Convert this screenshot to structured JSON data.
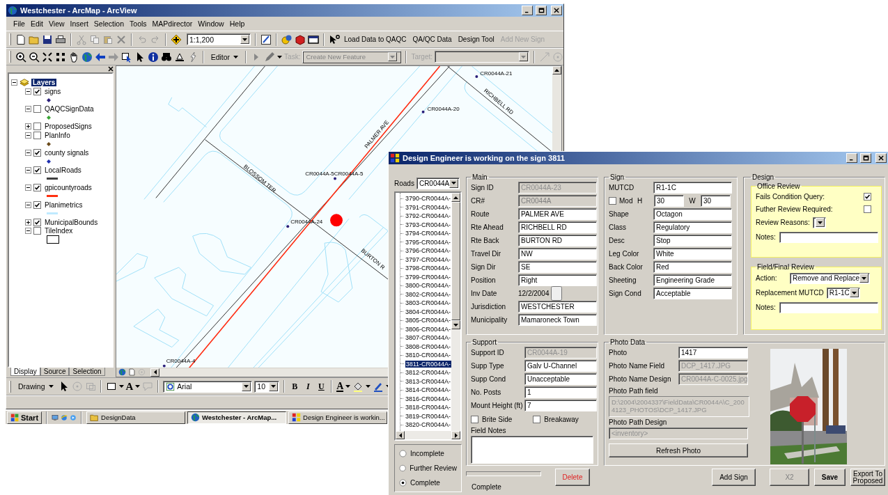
{
  "arcmap": {
    "title": "Westchester - ArcMap - ArcView",
    "menu": [
      "File",
      "Edit",
      "View",
      "Insert",
      "Selection",
      "Tools",
      "MAPdirector",
      "Window",
      "Help"
    ],
    "scale": "1:1,200",
    "commands": [
      {
        "label": "Load Data to QAQC",
        "disabled": false
      },
      {
        "label": "QA/QC Data",
        "disabled": false
      },
      {
        "label": "Design Tool",
        "disabled": false
      },
      {
        "label": "Add New Sign",
        "disabled": true
      }
    ],
    "editor": {
      "menu": "Editor",
      "task_label": "Task:",
      "task": "Create New Feature",
      "target_label": "Target:"
    },
    "toc": {
      "root": "Layers",
      "layers": [
        {
          "name": "signs",
          "checked": true,
          "expanded": true,
          "kind": "point",
          "color": "#2b1f7a"
        },
        {
          "name": "QAQCSignData",
          "checked": false,
          "expanded": true,
          "kind": "point",
          "color": "#3aa535"
        },
        {
          "name": "ProposedSigns",
          "checked": false,
          "expanded": false
        },
        {
          "name": "PlanInfo",
          "checked": false,
          "expanded": true,
          "kind": "point",
          "color": "#6b4a1a"
        },
        {
          "name": "county signals",
          "checked": true,
          "expanded": true,
          "kind": "point",
          "color": "#2030b0"
        },
        {
          "name": "LocalRoads",
          "checked": true,
          "expanded": true,
          "kind": "line",
          "color": "#404040"
        },
        {
          "name": "gpicountyroads",
          "checked": true,
          "expanded": true,
          "kind": "line",
          "color": "#ff3010"
        },
        {
          "name": "Planimetrics",
          "checked": true,
          "expanded": true,
          "kind": "line",
          "color": "#bfeaff"
        },
        {
          "name": "MunicipalBounds",
          "checked": true,
          "expanded": false
        },
        {
          "name": "TileIndex",
          "checked": false,
          "expanded": true,
          "kind": "polygon"
        }
      ],
      "tabs": [
        {
          "label": "Display",
          "selected": true
        },
        {
          "label": "Source",
          "selected": false
        },
        {
          "label": "Selection",
          "selected": false
        }
      ]
    },
    "map": {
      "labels": [
        {
          "text": "CR0044A-21",
          "kind": "point"
        },
        {
          "text": "RICHBELL RD",
          "kind": "road"
        },
        {
          "text": "CR0044A-20",
          "kind": "point"
        },
        {
          "text": "PALMER AVE",
          "kind": "road"
        },
        {
          "text": "BLOSSOM TER",
          "kind": "road"
        },
        {
          "text": "CR0044A-5CR0044A-5",
          "kind": "point"
        },
        {
          "text": "CR0044A-24",
          "kind": "point"
        },
        {
          "text": "BURTON R",
          "kind": "road"
        },
        {
          "text": "CR0044A-4",
          "kind": "point"
        }
      ]
    },
    "drawing_toolbar": {
      "menu": "Drawing",
      "text_tool": "A",
      "font": "Arial",
      "size": "10",
      "styles": [
        "B",
        "I",
        "U"
      ],
      "font_color": "A"
    },
    "taskbar": {
      "start": "Start",
      "tasks": [
        {
          "label": "DesignData",
          "selected": false
        },
        {
          "label": "Westchester - ArcMap...",
          "selected": true
        },
        {
          "label": "Design Engineer is workin...",
          "selected": false
        }
      ]
    }
  },
  "dialog": {
    "title": "Design Engineer is working on the sign 3811",
    "roads": {
      "label": "Roads",
      "value": "CR0044A"
    },
    "signs": [
      {
        "label": "3790-CR0044A-",
        "selected": false
      },
      {
        "label": "3791-CR0044A-",
        "selected": false
      },
      {
        "label": "3792-CR0044A-",
        "selected": false
      },
      {
        "label": "3793-CR0044A-",
        "selected": false
      },
      {
        "label": "3794-CR0044A-",
        "selected": false
      },
      {
        "label": "3795-CR0044A-",
        "selected": false
      },
      {
        "label": "3796-CR0044A-",
        "selected": false
      },
      {
        "label": "3797-CR0044A-",
        "selected": false
      },
      {
        "label": "3798-CR0044A-",
        "selected": false
      },
      {
        "label": "3799-CR0044A-",
        "selected": false
      },
      {
        "label": "3800-CR0044A-",
        "selected": false
      },
      {
        "label": "3802-CR0044A-",
        "selected": false
      },
      {
        "label": "3803-CR0044A-",
        "selected": false
      },
      {
        "label": "3804-CR0044A-",
        "selected": false
      },
      {
        "label": "3805-CR0044A-",
        "selected": false
      },
      {
        "label": "3806-CR0044A-",
        "selected": false
      },
      {
        "label": "3807-CR0044A-",
        "selected": false
      },
      {
        "label": "3808-CR0044A-",
        "selected": false
      },
      {
        "label": "3810-CR0044A-",
        "selected": false
      },
      {
        "label": "3811-CR0044A-",
        "selected": true
      },
      {
        "label": "3812-CR0044A-",
        "selected": false
      },
      {
        "label": "3813-CR0044A-",
        "selected": false
      },
      {
        "label": "3814-CR0044A-",
        "selected": false
      },
      {
        "label": "3816-CR0044A-",
        "selected": false
      },
      {
        "label": "3818-CR0044A-",
        "selected": false
      },
      {
        "label": "3819-CR0044A-",
        "selected": false
      },
      {
        "label": "3820-CR0044A-",
        "selected": false
      }
    ],
    "status": [
      {
        "label": "Incomplete",
        "selected": false
      },
      {
        "label": "Further Review",
        "selected": false
      },
      {
        "label": "Complete",
        "selected": true
      }
    ],
    "main": {
      "title": "Main",
      "fields": [
        {
          "label": "Sign ID",
          "value": "CR0044A-23",
          "kind": "text",
          "disabled": true
        },
        {
          "label": "CR#",
          "value": "CR0044A",
          "kind": "select",
          "disabled": true
        },
        {
          "label": "Route",
          "value": "PALMER AVE",
          "kind": "select",
          "disabled": false
        },
        {
          "label": "Rte Ahead",
          "value": "RICHBELL RD",
          "kind": "select",
          "disabled": false
        },
        {
          "label": "Rte Back",
          "value": "BURTON RD",
          "kind": "select",
          "disabled": false
        },
        {
          "label": "Travel Dir",
          "value": "NW",
          "kind": "select",
          "disabled": false
        },
        {
          "label": "Sign Dir",
          "value": "SE",
          "kind": "select",
          "disabled": false
        },
        {
          "label": "Position",
          "value": "Right",
          "kind": "select",
          "disabled": false
        },
        {
          "label": "Inv Date",
          "value": "12/2/2004",
          "kind": "date"
        },
        {
          "label": "Jurisdiction",
          "value": "WESTCHESTER",
          "kind": "select",
          "disabled": false
        },
        {
          "label": "Municipality",
          "value": "Mamaroneck Town",
          "kind": "select",
          "disabled": false
        }
      ]
    },
    "sign": {
      "title": "Sign",
      "mutcd": {
        "label": "MUTCD",
        "value": "R1-1C",
        "kind": "select",
        "disabled": false
      },
      "mod": {
        "label": "Mod",
        "checked": false
      },
      "height": {
        "label": "H",
        "value": "30"
      },
      "width": {
        "label": "W",
        "value": "30"
      },
      "fields": [
        {
          "label": "Shape",
          "value": "Octagon",
          "kind": "select",
          "disabled": false
        },
        {
          "label": "Class",
          "value": "Regulatory",
          "kind": "select",
          "disabled": false
        },
        {
          "label": "Desc",
          "value": "Stop",
          "kind": "select",
          "disabled": false
        },
        {
          "label": "Leg Color",
          "value": "White",
          "kind": "select",
          "disabled": false
        },
        {
          "label": "Back Color",
          "value": "Red",
          "kind": "select",
          "disabled": false
        },
        {
          "label": "Sheeting",
          "value": "Engineering Grade",
          "kind": "select",
          "disabled": false
        },
        {
          "label": "Sign Cond",
          "value": "Acceptable",
          "kind": "select",
          "disabled": false
        }
      ]
    },
    "design": {
      "title": "Design",
      "office": {
        "title": "Office Review",
        "checks": [
          {
            "label": "Fails Condition Query:",
            "checked": true
          },
          {
            "label": "Futher Review Required:",
            "checked": false
          }
        ],
        "reasons_label": "Review Reasons:",
        "notes_label": "Notes:"
      },
      "final": {
        "title": "Field/Final Review",
        "action": {
          "label": "Action:",
          "value": "Remove and Replace"
        },
        "replacement": {
          "label": "Replacement MUTCD",
          "value": "R1-1C"
        },
        "notes_label": "Notes:"
      }
    },
    "support": {
      "title": "Support",
      "fields": [
        {
          "label": "Support ID",
          "value": "CR0044A-19",
          "kind": "text",
          "disabled": true
        },
        {
          "label": "Supp Type",
          "value": "Galv U-Channel",
          "kind": "select",
          "disabled": false
        },
        {
          "label": "Supp Cond",
          "value": "Unacceptable",
          "kind": "select",
          "disabled": false
        },
        {
          "label": "No. Posts",
          "value": "1",
          "kind": "text",
          "disabled": false
        },
        {
          "label": "Mount Height (ft)",
          "value": "7",
          "kind": "text",
          "disabled": false
        }
      ],
      "checks": [
        {
          "label": "Brite Side",
          "checked": false
        },
        {
          "label": "Breakaway",
          "checked": false
        }
      ],
      "notes_label": "Field Notes"
    },
    "photo": {
      "title": "Photo Data",
      "fields": [
        {
          "label": "Photo",
          "value": "1417",
          "kind": "text",
          "disabled": false
        },
        {
          "label": "Photo Name Field",
          "value": "DCP_1417.JPG",
          "kind": "text",
          "disabled": true
        },
        {
          "label": "Photo Name Design",
          "value": "CR0044A-C-0025.jpg",
          "kind": "text",
          "disabled": true
        }
      ],
      "path_field": {
        "label": "Photo Path field",
        "value": "D:\\2004\\2004337\\FieldData\\CR0044A\\C_2004123_PHOTOS\\DCP_1417.JPG"
      },
      "path_design": {
        "label": "Photo Path Design",
        "value": "<inventory>"
      },
      "refresh": "Refresh Photo"
    },
    "progress": {
      "level": 0,
      "label": "Complete"
    },
    "delete": {
      "label": "Delete",
      "kind": "danger"
    },
    "buttons": [
      {
        "label": "Add Sign",
        "kind": "normal",
        "disabled": false
      },
      {
        "label": "X2",
        "kind": "normal",
        "disabled": true
      },
      {
        "label": "Save",
        "kind": "primary",
        "disabled": false
      },
      {
        "label": "Export To Proposed",
        "kind": "normal",
        "disabled": false
      }
    ]
  }
}
